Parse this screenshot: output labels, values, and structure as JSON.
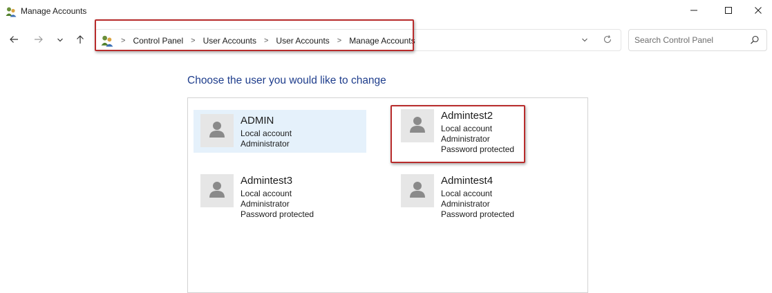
{
  "window": {
    "title": "Manage Accounts",
    "icon": "user-accounts-icon"
  },
  "window_controls": {
    "minimize_icon": "minimize-icon",
    "maximize_icon": "maximize-icon",
    "close_icon": "close-icon"
  },
  "nav": {
    "back_icon": "arrow-left-icon",
    "forward_icon": "arrow-right-icon",
    "recent_icon": "chevron-down-icon",
    "up_icon": "arrow-up-icon"
  },
  "address": {
    "icon": "user-accounts-icon",
    "separator": ">",
    "crumbs": [
      "Control Panel",
      "User Accounts",
      "User Accounts",
      "Manage Accounts"
    ],
    "dropdown_icon": "chevron-down-icon",
    "refresh_icon": "refresh-icon"
  },
  "search": {
    "placeholder": "Search Control Panel",
    "value": "",
    "icon": "search-icon"
  },
  "main": {
    "heading": "Choose the user you would like to change",
    "accounts": [
      {
        "name": "ADMIN",
        "lines": [
          "Local account",
          "Administrator",
          ""
        ],
        "selected": true
      },
      {
        "name": "Admintest2",
        "lines": [
          "Local account",
          "Administrator",
          "Password protected"
        ],
        "selected": false
      },
      {
        "name": "Admintest3",
        "lines": [
          "Local account",
          "Administrator",
          "Password protected"
        ],
        "selected": false
      },
      {
        "name": "Admintest4",
        "lines": [
          "Local account",
          "Administrator",
          "Password protected"
        ],
        "selected": false
      }
    ]
  },
  "colors": {
    "heading": "#1e3d8c",
    "selected_bg": "#e5f1fb",
    "highlight_box": "#b82b2b",
    "avatar_bg": "#e6e6e6",
    "avatar_fg": "#8a8a8a"
  }
}
